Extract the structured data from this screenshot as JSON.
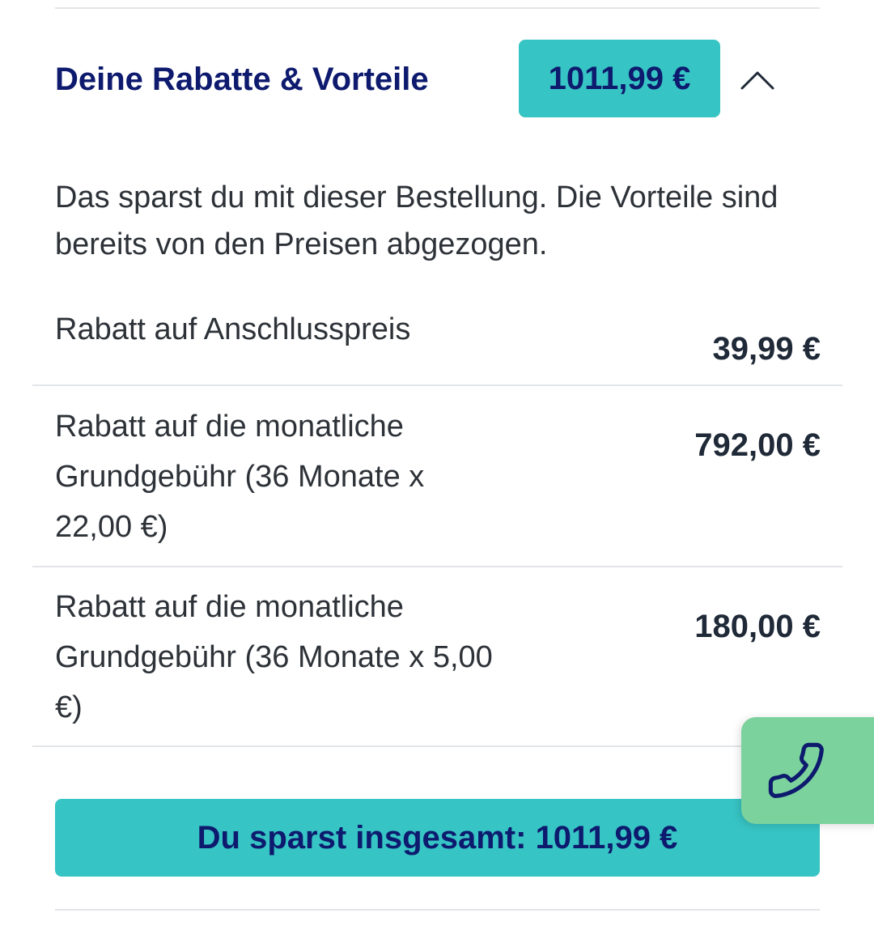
{
  "discounts": {
    "title": "Deine Rabatte & Vorteile",
    "total_badge": "1011,99 €",
    "toggle_icon": "chevron-up-icon",
    "intro": "Das sparst du mit dieser Bestellung. Die Vorteile sind bereits von den Preisen abgezogen.",
    "items": [
      {
        "label": "Rabatt auf Anschlusspreis",
        "amount": "39,99 €"
      },
      {
        "label": "Rabatt auf die monatliche Grundgebühr (36 Monate x 22,00 €)",
        "amount": "792,00 €"
      },
      {
        "label": "Rabatt auf die monatliche Grundgebühr (36 Monate x 5,00 €)",
        "amount": "180,00 €"
      }
    ],
    "summary": "Du sparst insgesamt: 1011,99 €"
  },
  "call_button": {
    "icon": "phone-icon"
  },
  "colors": {
    "accent_teal": "#37c4c4",
    "navy": "#0d1a6e",
    "call_green": "#7bd29c"
  }
}
